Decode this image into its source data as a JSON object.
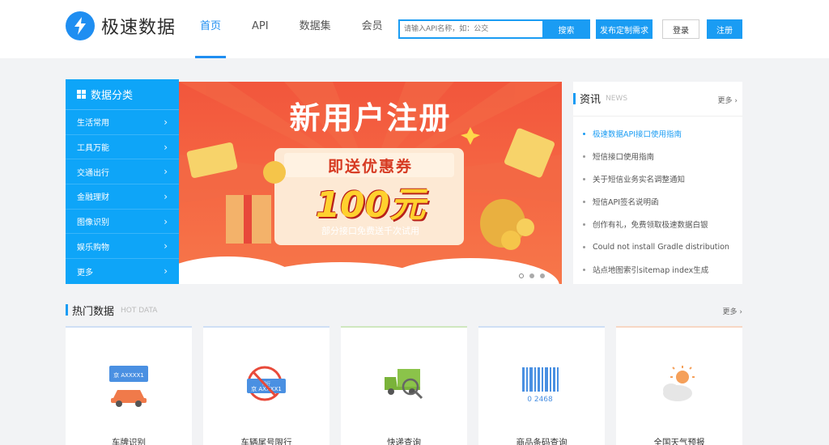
{
  "header": {
    "brand": "极速数据",
    "nav": [
      "首页",
      "API",
      "数据集",
      "会员"
    ],
    "search_placeholder": "请输入API名称，如：公交",
    "search_label": "搜索",
    "custom_label": "发布定制需求",
    "login_label": "登录",
    "register_label": "注册"
  },
  "colors": {
    "accent": "#1a9cf3",
    "sidebar": "#0ea5f8",
    "banner": "#f0523a"
  },
  "categories": {
    "title": "数据分类",
    "items": [
      "生活常用",
      "工具万能",
      "交通出行",
      "金融理财",
      "图像识别",
      "娱乐购物",
      "更多"
    ]
  },
  "banner": {
    "title": "新用户注册",
    "sub": "即送优惠券",
    "big": "100元",
    "note": "部分接口免费送千次试用",
    "slide_count": 3,
    "active_slide": 1
  },
  "news": {
    "title": "资讯",
    "en": "NEWS",
    "more": "更多 ›",
    "items": [
      "极速数据API接口使用指南",
      "短信接口使用指南",
      "关于短信业务实名调整通知",
      "短信API签名说明函",
      "创作有礼，免费领取极速数据白银",
      "Could not install Gradle distribution",
      "站点地图索引sitemap index生成"
    ]
  },
  "hot": {
    "title": "热门数据",
    "en": "HOT DATA",
    "more": "更多 ›",
    "cards": [
      {
        "label": "车牌识别",
        "icon": "license-plate-car-icon",
        "color": "#4a90e2",
        "plate": "京 AXXXX1"
      },
      {
        "label": "车辆尾号限行",
        "icon": "restricted-plate-icon",
        "color": "#4a90e2",
        "plate": "京 AXXXX1",
        "badge": "限行"
      },
      {
        "label": "快递查询",
        "icon": "delivery-truck-icon",
        "color": "#8bc34a"
      },
      {
        "label": "商品条码查询",
        "icon": "barcode-icon",
        "color": "#4a90e2",
        "code": "0 2468"
      },
      {
        "label": "全国天气预报",
        "icon": "weather-sun-cloud-icon",
        "color": "#f5a05a"
      }
    ]
  }
}
